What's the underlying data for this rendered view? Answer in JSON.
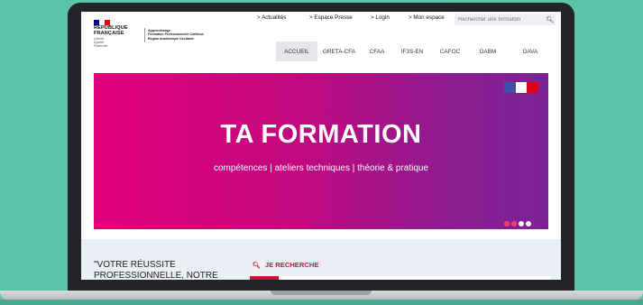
{
  "header": {
    "flag_colors": [
      "#000091",
      "#ffffff",
      "#e1000f"
    ],
    "rf_line1": "RÉPUBLIQUE",
    "rf_line2": "FRANÇAISE",
    "motto": [
      "Liberté",
      "Égalité",
      "Fraternité"
    ],
    "tagline": [
      "Apprentissage",
      "Formation Professionnelle Continue",
      "Région académique Occitanie"
    ]
  },
  "topnav": {
    "links": [
      "> Actualités",
      "> Espace Presse",
      "> Login",
      "> Mon espace"
    ],
    "search_placeholder": "Rechercher une formation"
  },
  "mainnav": {
    "items": [
      "ACCUEIL",
      "GRETA-CFA",
      "CFAA",
      "IF3S-EN",
      "CAFOC",
      "DABM",
      "DAVA"
    ],
    "active": "ACCUEIL"
  },
  "hero": {
    "title": "TA FORMATION",
    "subtitle": "compétences | ateliers techniques | théorie & pratique",
    "slides_active_index": 2,
    "dot_colors": [
      "#ff3a6e",
      "#ff3a6e",
      "#ffffff",
      "#ffffff"
    ]
  },
  "lower": {
    "quote_line1": "\"VOTRE RÉUSSITE",
    "quote_line2": "PROFESSIONNELLE, NOTRE",
    "search_heading": "JE RECHERCHE"
  }
}
